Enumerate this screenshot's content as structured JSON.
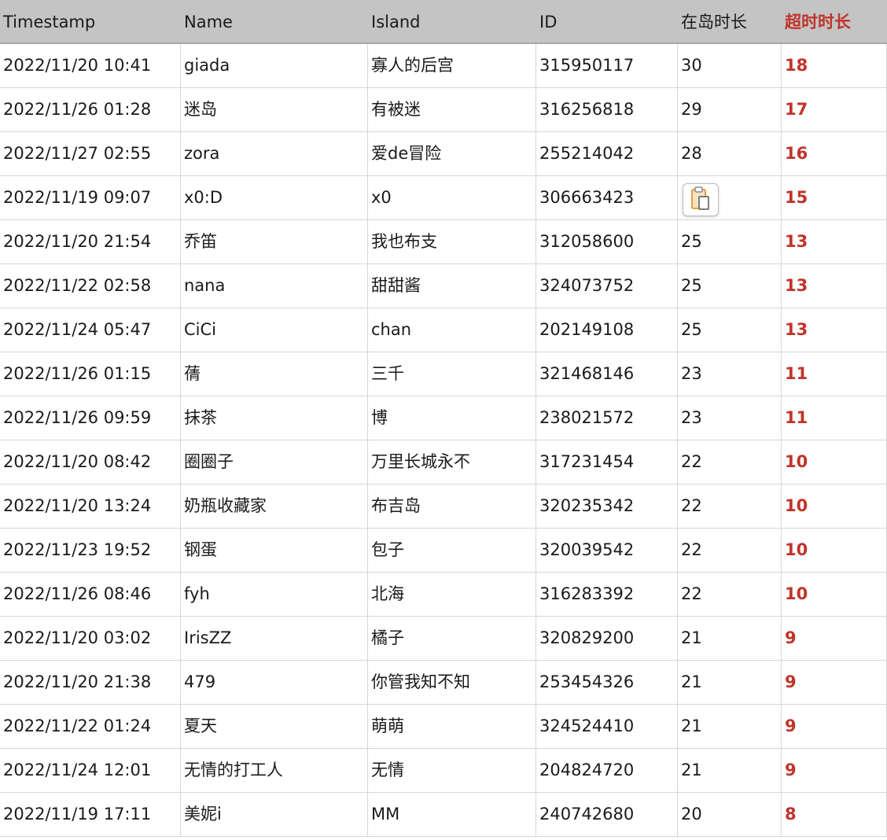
{
  "columns": [
    "Timestamp",
    "Name",
    "Island",
    "ID",
    "在岛时长",
    "超时时长"
  ],
  "colors": {
    "accent_red": "#c0342a",
    "header_bg": "#c4c4c4"
  },
  "rows": [
    [
      "2022/11/20 10:41",
      "giada",
      "寡人的后宫",
      "315950117",
      "30",
      "18"
    ],
    [
      "2022/11/26 01:28",
      "迷岛",
      "有被迷",
      "316256818",
      "29",
      "17"
    ],
    [
      "2022/11/27 02:55",
      "zora",
      "爱de冒险",
      "255214042",
      "28",
      "16"
    ],
    [
      "2022/11/19 09:07",
      "x0:D",
      "x0",
      "306663423",
      "",
      "15"
    ],
    [
      "2022/11/20 21:54",
      "乔笛",
      "我也布支",
      "312058600",
      "25",
      "13"
    ],
    [
      "2022/11/22 02:58",
      "nana",
      "甜甜酱",
      "324073752",
      "25",
      "13"
    ],
    [
      "2022/11/24 05:47",
      "CiCi",
      "chan",
      "202149108",
      "25",
      "13"
    ],
    [
      "2022/11/26 01:15",
      "蒨",
      "三千",
      "321468146",
      "23",
      "11"
    ],
    [
      "2022/11/26 09:59",
      "抹茶",
      "博",
      "238021572",
      "23",
      "11"
    ],
    [
      "2022/11/20 08:42",
      "圈圈子",
      "万里长城永不",
      "317231454",
      "22",
      "10"
    ],
    [
      "2022/11/20 13:24",
      "奶瓶收藏家",
      "布吉岛",
      "320235342",
      "22",
      "10"
    ],
    [
      "2022/11/23 19:52",
      "钢蛋",
      "包子",
      "320039542",
      "22",
      "10"
    ],
    [
      "2022/11/26 08:46",
      "fyh",
      "北海",
      "316283392",
      "22",
      "10"
    ],
    [
      "2022/11/20 03:02",
      "IrisZZ",
      "橘子",
      "320829200",
      "21",
      "9"
    ],
    [
      "2022/11/20 21:38",
      "479",
      "你管我知不知",
      "253454326",
      "21",
      "9"
    ],
    [
      "2022/11/22 01:24",
      "夏天",
      "萌萌",
      "324524410",
      "21",
      "9"
    ],
    [
      "2022/11/24 12:01",
      "无情的打工人",
      "无情",
      "204824720",
      "21",
      "9"
    ],
    [
      "2022/11/19 17:11",
      "美妮i",
      "MM",
      "240742680",
      "20",
      "8"
    ]
  ],
  "paste_button": {
    "icon": "paste-clipboard-icon"
  }
}
